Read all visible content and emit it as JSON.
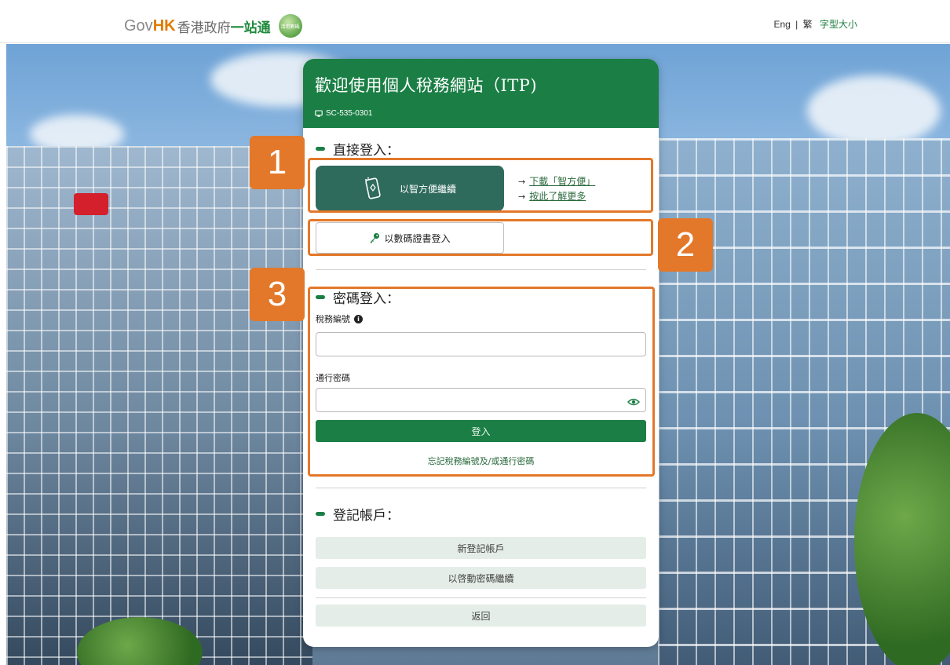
{
  "header": {
    "brand_gov": "Gov",
    "brand_hk": "HK",
    "brand_zh": "香港政府",
    "brand_zh2": "一站通",
    "badge_text": "活用數碼",
    "lang_eng": "Eng",
    "lang_sep": "|",
    "lang_trad": "繁",
    "font_size": "字型大小"
  },
  "panel": {
    "title": "歡迎使用個人稅務網站（ITP)",
    "code": "SC-535-0301",
    "direct_login": {
      "heading": "直接登入：",
      "iamsmart_label": "以智方便繼續",
      "download_link": "下載「智方便」",
      "learn_more_link": "按此了解更多",
      "link_arrow": "→",
      "cert_label": "以數碼證書登入"
    },
    "password_login": {
      "heading": "密碼登入：",
      "tax_no_label": "稅務編號",
      "tax_no_value": "",
      "password_label": "通行密碼",
      "password_value": "",
      "login_button": "登入",
      "forgot_link": "忘記稅務編號及/或通行密碼"
    },
    "register": {
      "heading": "登記帳戶：",
      "new_account": "新登記帳戶",
      "activation": "以啓動密碼繼續",
      "back": "返回"
    }
  },
  "annotations": [
    "1",
    "2",
    "3"
  ],
  "colors": {
    "primary_green": "#1b7f45",
    "iamsmart_button": "#2f6b5c",
    "highlight_orange": "#e3782a",
    "soft_button": "#e4ede7"
  },
  "icons": [
    "mobile-phone-icon",
    "key-icon",
    "info-icon",
    "eye-icon",
    "monitor-icon"
  ]
}
